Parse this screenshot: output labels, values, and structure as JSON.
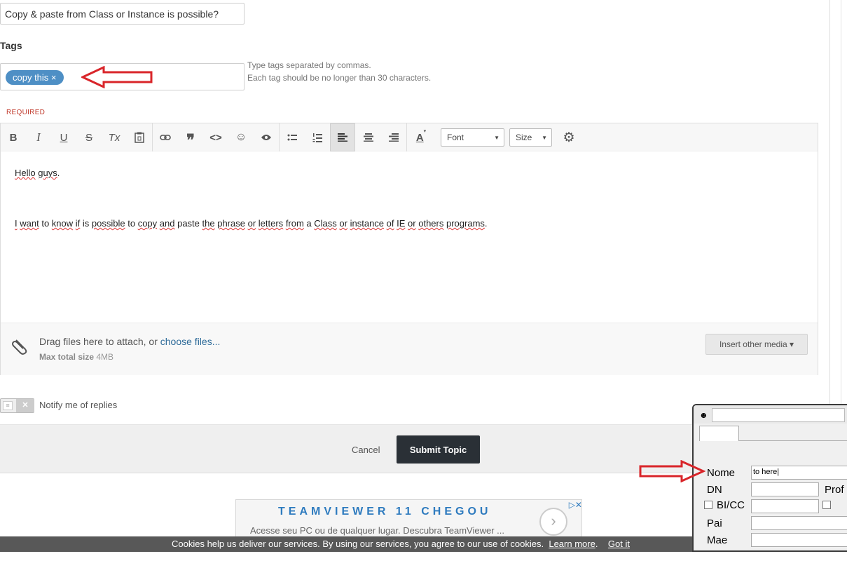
{
  "topic": {
    "title_value": "Copy & paste from Class or Instance is possible?"
  },
  "tags": {
    "label": "Tags",
    "chip": "copy this ×",
    "hint_line1": "Type tags separated by commas.",
    "hint_line2": "Each tag should be no longer than 30 characters.",
    "required": "REQUIRED"
  },
  "toolbar": {
    "bold": "B",
    "italic": "I",
    "underline": "U",
    "strike": "S",
    "clear_format": "Tx",
    "font_select": "Font",
    "size_select": "Size"
  },
  "content": {
    "greeting_words": [
      "Hello",
      "guys",
      "."
    ],
    "body_segments": [
      "I",
      " ",
      "want",
      " to ",
      "know",
      " ",
      "if",
      " is ",
      "possible",
      " to ",
      "copy",
      " ",
      "and",
      " paste ",
      "the",
      " ",
      "phrase",
      " ",
      "or",
      " ",
      "letters",
      " ",
      "from",
      " a ",
      "Class",
      " ",
      "or",
      " ",
      "instance",
      " ",
      "of",
      " ",
      "IE",
      " ",
      "or",
      " ",
      "others",
      " ",
      "programs",
      "."
    ]
  },
  "attach": {
    "drag_text": "Drag files here to attach, or ",
    "choose_link": "choose files...",
    "max_label": "Max total size",
    "max_value": "4MB",
    "insert_media": "Insert other media ▾"
  },
  "notify": {
    "label": "Notify me of replies"
  },
  "actions": {
    "cancel": "Cancel",
    "submit": "Submit Topic"
  },
  "ad": {
    "title": "TEAMVIEWER 11 CHEGOU",
    "description": "Acesse seu PC ou de qualquer lugar. Descubra TeamViewer ...",
    "close": "▷✕"
  },
  "cookie": {
    "text": "Cookies help us deliver our services. By using our services, you agree to our use of cookies.",
    "learn_more": "Learn more",
    "got_it": "Got it"
  },
  "overlay_window": {
    "fields": {
      "nome_label": "Nome",
      "nome_value": "to here|",
      "dn_label": "DN",
      "prof_label": "Prof",
      "bicc_label": "BI/CC",
      "pai_label": "Pai",
      "mae_label": "Mae"
    }
  },
  "colors": {
    "annotation_arrow": "#d9252a",
    "tag_chip": "#4e8fc5",
    "submit_bg": "#2a3036"
  }
}
